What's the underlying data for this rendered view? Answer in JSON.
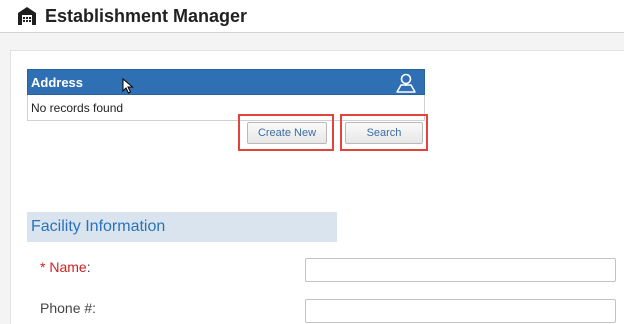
{
  "header": {
    "title": "Establishment Manager",
    "icon": "warehouse-icon"
  },
  "address_grid": {
    "title": "Address",
    "empty_text": "No records found",
    "map_icon": "map-pin-icon",
    "header_color": "#2f6fb3"
  },
  "actions": {
    "create_label": "Create New",
    "search_label": "Search"
  },
  "facility": {
    "section_title": "Facility Information",
    "name_required": "* ",
    "name_label": "Name",
    "name_colon": ":",
    "name_value": "",
    "phone_label": "Phone #:",
    "phone_value": ""
  },
  "colors": {
    "highlight": "#e0443b",
    "required": "#d21f1f",
    "section_bg": "#d9e4ef",
    "section_text": "#2a73b8"
  }
}
